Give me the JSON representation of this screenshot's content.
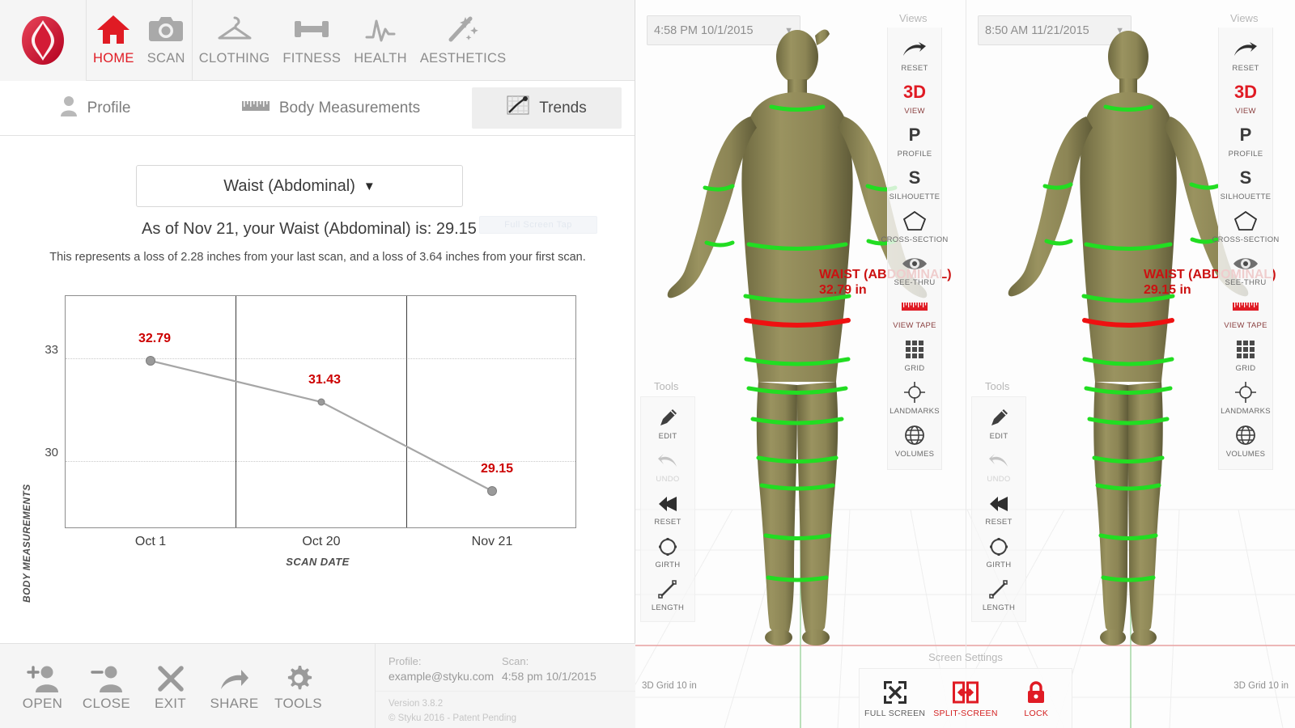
{
  "app": {
    "logo_name": "styku-logo",
    "accent_red": "#e01b24",
    "label_red": "#cc0000",
    "body_color": "#8a8455",
    "band_green": "#22dd22",
    "band_red": "#ee1111"
  },
  "topnav": {
    "items": [
      {
        "label": "HOME",
        "icon": "home-icon",
        "active": true
      },
      {
        "label": "SCAN",
        "icon": "camera-icon",
        "active": false
      },
      {
        "label": "CLOTHING",
        "icon": "hanger-icon",
        "active": false
      },
      {
        "label": "FITNESS",
        "icon": "dumbbell-icon",
        "active": false
      },
      {
        "label": "HEALTH",
        "icon": "heartbeat-icon",
        "active": false
      },
      {
        "label": "AESTHETICS",
        "icon": "magic-wand-icon",
        "active": false
      }
    ]
  },
  "subtabs": [
    {
      "label": "Profile",
      "icon": "person-icon",
      "active": false
    },
    {
      "label": "Body Measurements",
      "icon": "ruler-icon",
      "active": false
    },
    {
      "label": "Trends",
      "icon": "trend-chart-icon",
      "active": true
    }
  ],
  "trends": {
    "measurement_select": "Waist (Abdominal)",
    "caret": "▼",
    "summary": "As of Nov 21, your Waist (Abdominal) is: 29.15 in",
    "detail": "This represents a loss of 2.28 inches from your last scan, and a loss of 3.64 inches from your first scan.",
    "fullscreen_ghost_label": "Full Screen Tap"
  },
  "chart_data": {
    "type": "line",
    "title": "",
    "xlabel": "SCAN DATE",
    "ylabel": "BODY MEASUREMENTS",
    "categories": [
      "Oct 1",
      "Oct 20",
      "Nov 21"
    ],
    "values": [
      32.79,
      31.43,
      29.15
    ],
    "point_labels": [
      "32.79",
      "31.43",
      "29.15"
    ],
    "yticks": [
      33,
      30
    ],
    "ytick_labels": [
      "33",
      "30"
    ],
    "ylim": [
      27.6,
      34.4
    ],
    "grid": true,
    "legend": "none",
    "series": [
      {
        "name": "Waist (Abdominal)",
        "values": [
          32.79,
          31.43,
          29.15
        ]
      }
    ]
  },
  "bottombar": {
    "actions": [
      {
        "label": "OPEN",
        "icon": "add-user-icon"
      },
      {
        "label": "CLOSE",
        "icon": "remove-user-icon"
      },
      {
        "label": "EXIT",
        "icon": "close-x-icon"
      },
      {
        "label": "SHARE",
        "icon": "share-arrow-icon"
      },
      {
        "label": "TOOLS",
        "icon": "gear-icon"
      }
    ],
    "profile_caption": "Profile:",
    "profile_value": "example@styku.com",
    "scan_caption": "Scan:",
    "scan_value": "4:58 pm 10/1/2015",
    "version": "Version 3.8.2",
    "copyright": "© Styku 2016 - Patent Pending"
  },
  "viewer": {
    "panes": [
      {
        "date": "4:58 PM 10/1/2015",
        "caret": "▼",
        "measurement_name": "WAIST (ABDOMINAL)",
        "measurement_value": "32.79 in",
        "grid_note": "3D Grid 10 in"
      },
      {
        "date": "8:50 AM 11/21/2015",
        "caret": "▼",
        "measurement_name": "WAIST (ABDOMINAL)",
        "measurement_value": "29.15 in",
        "grid_note": "3D Grid 10 in"
      }
    ],
    "views_caption": "Views",
    "views": [
      {
        "label": "RESET",
        "glyph": "",
        "icon": "reset-arrow-icon",
        "red": false
      },
      {
        "label": "VIEW",
        "glyph": "3D",
        "icon": "3d-view-icon",
        "red": true
      },
      {
        "label": "PROFILE",
        "glyph": "P",
        "icon": "profile-view-icon",
        "red": false
      },
      {
        "label": "SILHOUETTE",
        "glyph": "S",
        "icon": "silhouette-icon",
        "red": false
      },
      {
        "label": "CROSS-SECTION",
        "glyph": "",
        "icon": "pentagon-icon",
        "red": false
      },
      {
        "label": "SEE-THRU",
        "glyph": "",
        "icon": "eye-icon",
        "red": false
      },
      {
        "label": "VIEW TAPE",
        "glyph": "",
        "icon": "tape-measure-icon",
        "red": true
      },
      {
        "label": "GRID",
        "glyph": "",
        "icon": "grid-icon",
        "red": false
      },
      {
        "label": "LANDMARKS",
        "glyph": "",
        "icon": "crosshair-icon",
        "red": false
      },
      {
        "label": "VOLUMES",
        "glyph": "",
        "icon": "globe-icon",
        "red": false
      }
    ],
    "tools_caption": "Tools",
    "tools": [
      {
        "label": "EDIT",
        "icon": "pencil-icon",
        "disabled": false
      },
      {
        "label": "UNDO",
        "icon": "undo-arrow-icon",
        "disabled": true
      },
      {
        "label": "RESET",
        "icon": "reset-back-icon",
        "disabled": false
      },
      {
        "label": "GIRTH",
        "icon": "girth-circle-icon",
        "disabled": false
      },
      {
        "label": "LENGTH",
        "icon": "length-line-icon",
        "disabled": false
      }
    ],
    "screen_settings_caption": "Screen Settings",
    "screen_settings": [
      {
        "label": "FULL SCREEN",
        "icon": "fullscreen-icon",
        "red": false
      },
      {
        "label": "SPLIT-SCREEN",
        "icon": "splitscreen-icon",
        "red": true
      },
      {
        "label": "LOCK",
        "icon": "lock-icon",
        "red": true
      }
    ]
  }
}
